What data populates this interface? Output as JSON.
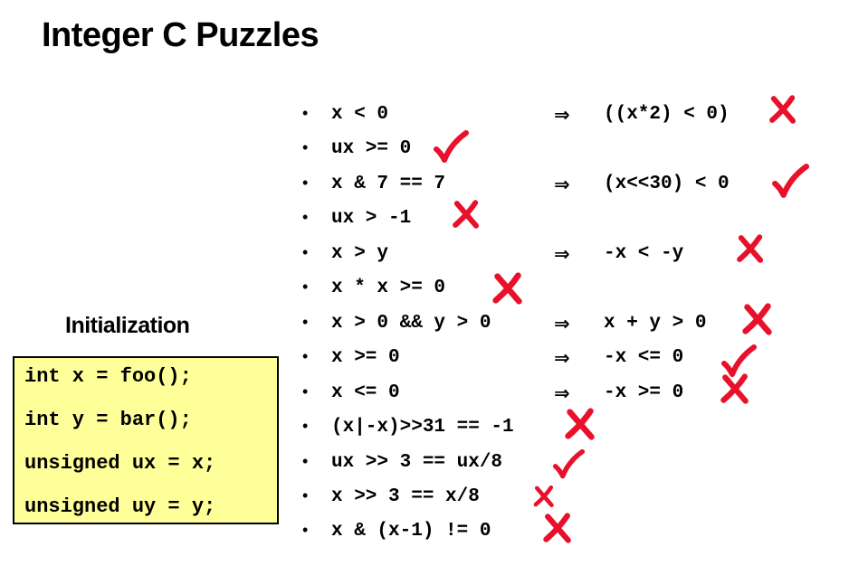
{
  "title": "Integer C Puzzles",
  "initialization": {
    "heading": "Initialization",
    "lines": [
      "int x = foo();",
      "int y = bar();",
      "unsigned ux = x;",
      "unsigned uy = y;"
    ]
  },
  "colors": {
    "mark": "#e8102a",
    "box_fill": "#ffff99"
  },
  "bullet_glyph": "•",
  "implies_glyph": "⇒",
  "puzzles": [
    {
      "lhs": "x < 0",
      "rhs": "((x*2) < 0)",
      "mark": "cross-icon"
    },
    {
      "lhs": "ux >= 0",
      "rhs": "",
      "mark": "check-icon"
    },
    {
      "lhs": "x & 7 == 7",
      "rhs": "(x<<30) < 0",
      "mark": "check-icon"
    },
    {
      "lhs": "ux > -1",
      "rhs": "",
      "mark": "cross-icon"
    },
    {
      "lhs": "x > y",
      "rhs": "-x < -y",
      "mark": "cross-icon"
    },
    {
      "lhs": "x * x >= 0",
      "rhs": "",
      "mark": "cross-icon"
    },
    {
      "lhs": "x > 0 && y > 0",
      "rhs": "x + y > 0",
      "mark": "cross-icon"
    },
    {
      "lhs": "x >= 0",
      "rhs": "-x <= 0",
      "mark": "check-icon"
    },
    {
      "lhs": "x <= 0",
      "rhs": "-x >= 0",
      "mark": "cross-icon"
    },
    {
      "lhs": "(x|-x)>>31 == -1",
      "rhs": "",
      "mark": "cross-icon"
    },
    {
      "lhs": "ux >> 3 == ux/8",
      "rhs": "",
      "mark": "check-icon"
    },
    {
      "lhs": "x >> 3 == x/8",
      "rhs": "",
      "mark": "cross-icon"
    },
    {
      "lhs": "x & (x-1) != 0",
      "rhs": "",
      "mark": "cross-icon"
    }
  ]
}
